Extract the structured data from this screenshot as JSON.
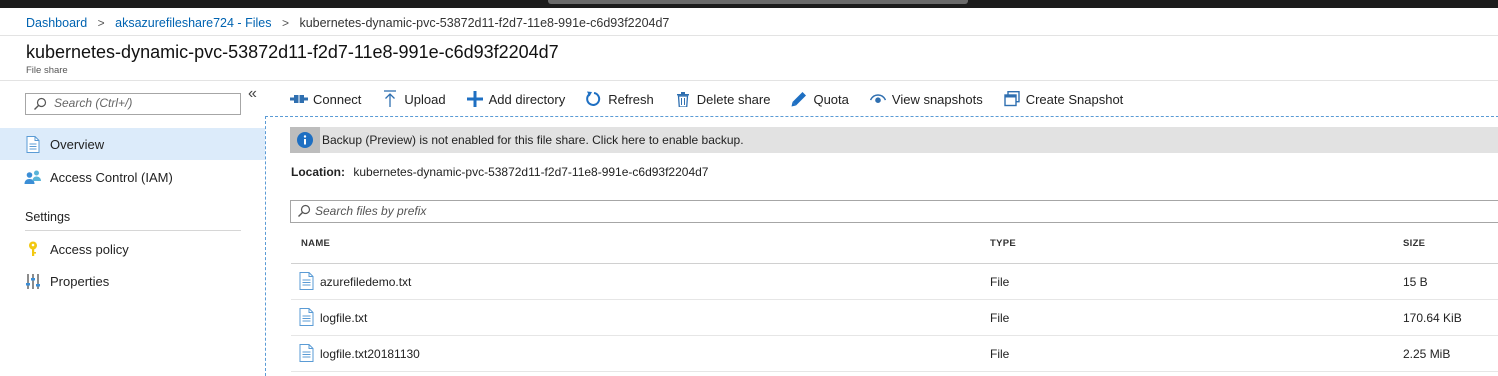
{
  "breadcrumb": {
    "items": [
      "Dashboard",
      "aksazurefileshare724 - Files"
    ],
    "current": "kubernetes-dynamic-pvc-53872d11-f2d7-11e8-991e-c6d93f2204d7",
    "separator": ">"
  },
  "header": {
    "title": "kubernetes-dynamic-pvc-53872d11-f2d7-11e8-991e-c6d93f2204d7",
    "subtitle": "File share"
  },
  "sidebar": {
    "search_placeholder": "Search (Ctrl+/)",
    "collapse_glyph": "«",
    "items": [
      {
        "label": "Overview",
        "icon": "document-icon",
        "active": true
      },
      {
        "label": "Access Control (IAM)",
        "icon": "users-icon",
        "active": false
      }
    ],
    "section_label": "Settings",
    "settings_items": [
      {
        "label": "Access policy",
        "icon": "key-icon"
      },
      {
        "label": "Properties",
        "icon": "properties-icon"
      }
    ]
  },
  "toolbar": {
    "connect": "Connect",
    "upload": "Upload",
    "add_directory": "Add directory",
    "refresh": "Refresh",
    "delete_share": "Delete share",
    "quota": "Quota",
    "view_snapshots": "View snapshots",
    "create_snapshot": "Create Snapshot"
  },
  "banner": {
    "text": "Backup (Preview) is not enabled for this file share. Click here to enable backup."
  },
  "location": {
    "label": "Location:",
    "value": "kubernetes-dynamic-pvc-53872d11-f2d7-11e8-991e-c6d93f2204d7"
  },
  "files": {
    "search_placeholder": "Search files by prefix",
    "columns": [
      "NAME",
      "TYPE",
      "SIZE"
    ],
    "rows": [
      {
        "name": "azurefiledemo.txt",
        "type": "File",
        "size": "15 B"
      },
      {
        "name": "logfile.txt",
        "type": "File",
        "size": "170.64 KiB"
      },
      {
        "name": "logfile.txt20181130",
        "type": "File",
        "size": "2.25 MiB"
      }
    ]
  },
  "colors": {
    "accent": "#0078d4",
    "link": "#0063b1",
    "active_nav": "#dcebfa",
    "banner_bg": "#e2e2e2"
  }
}
